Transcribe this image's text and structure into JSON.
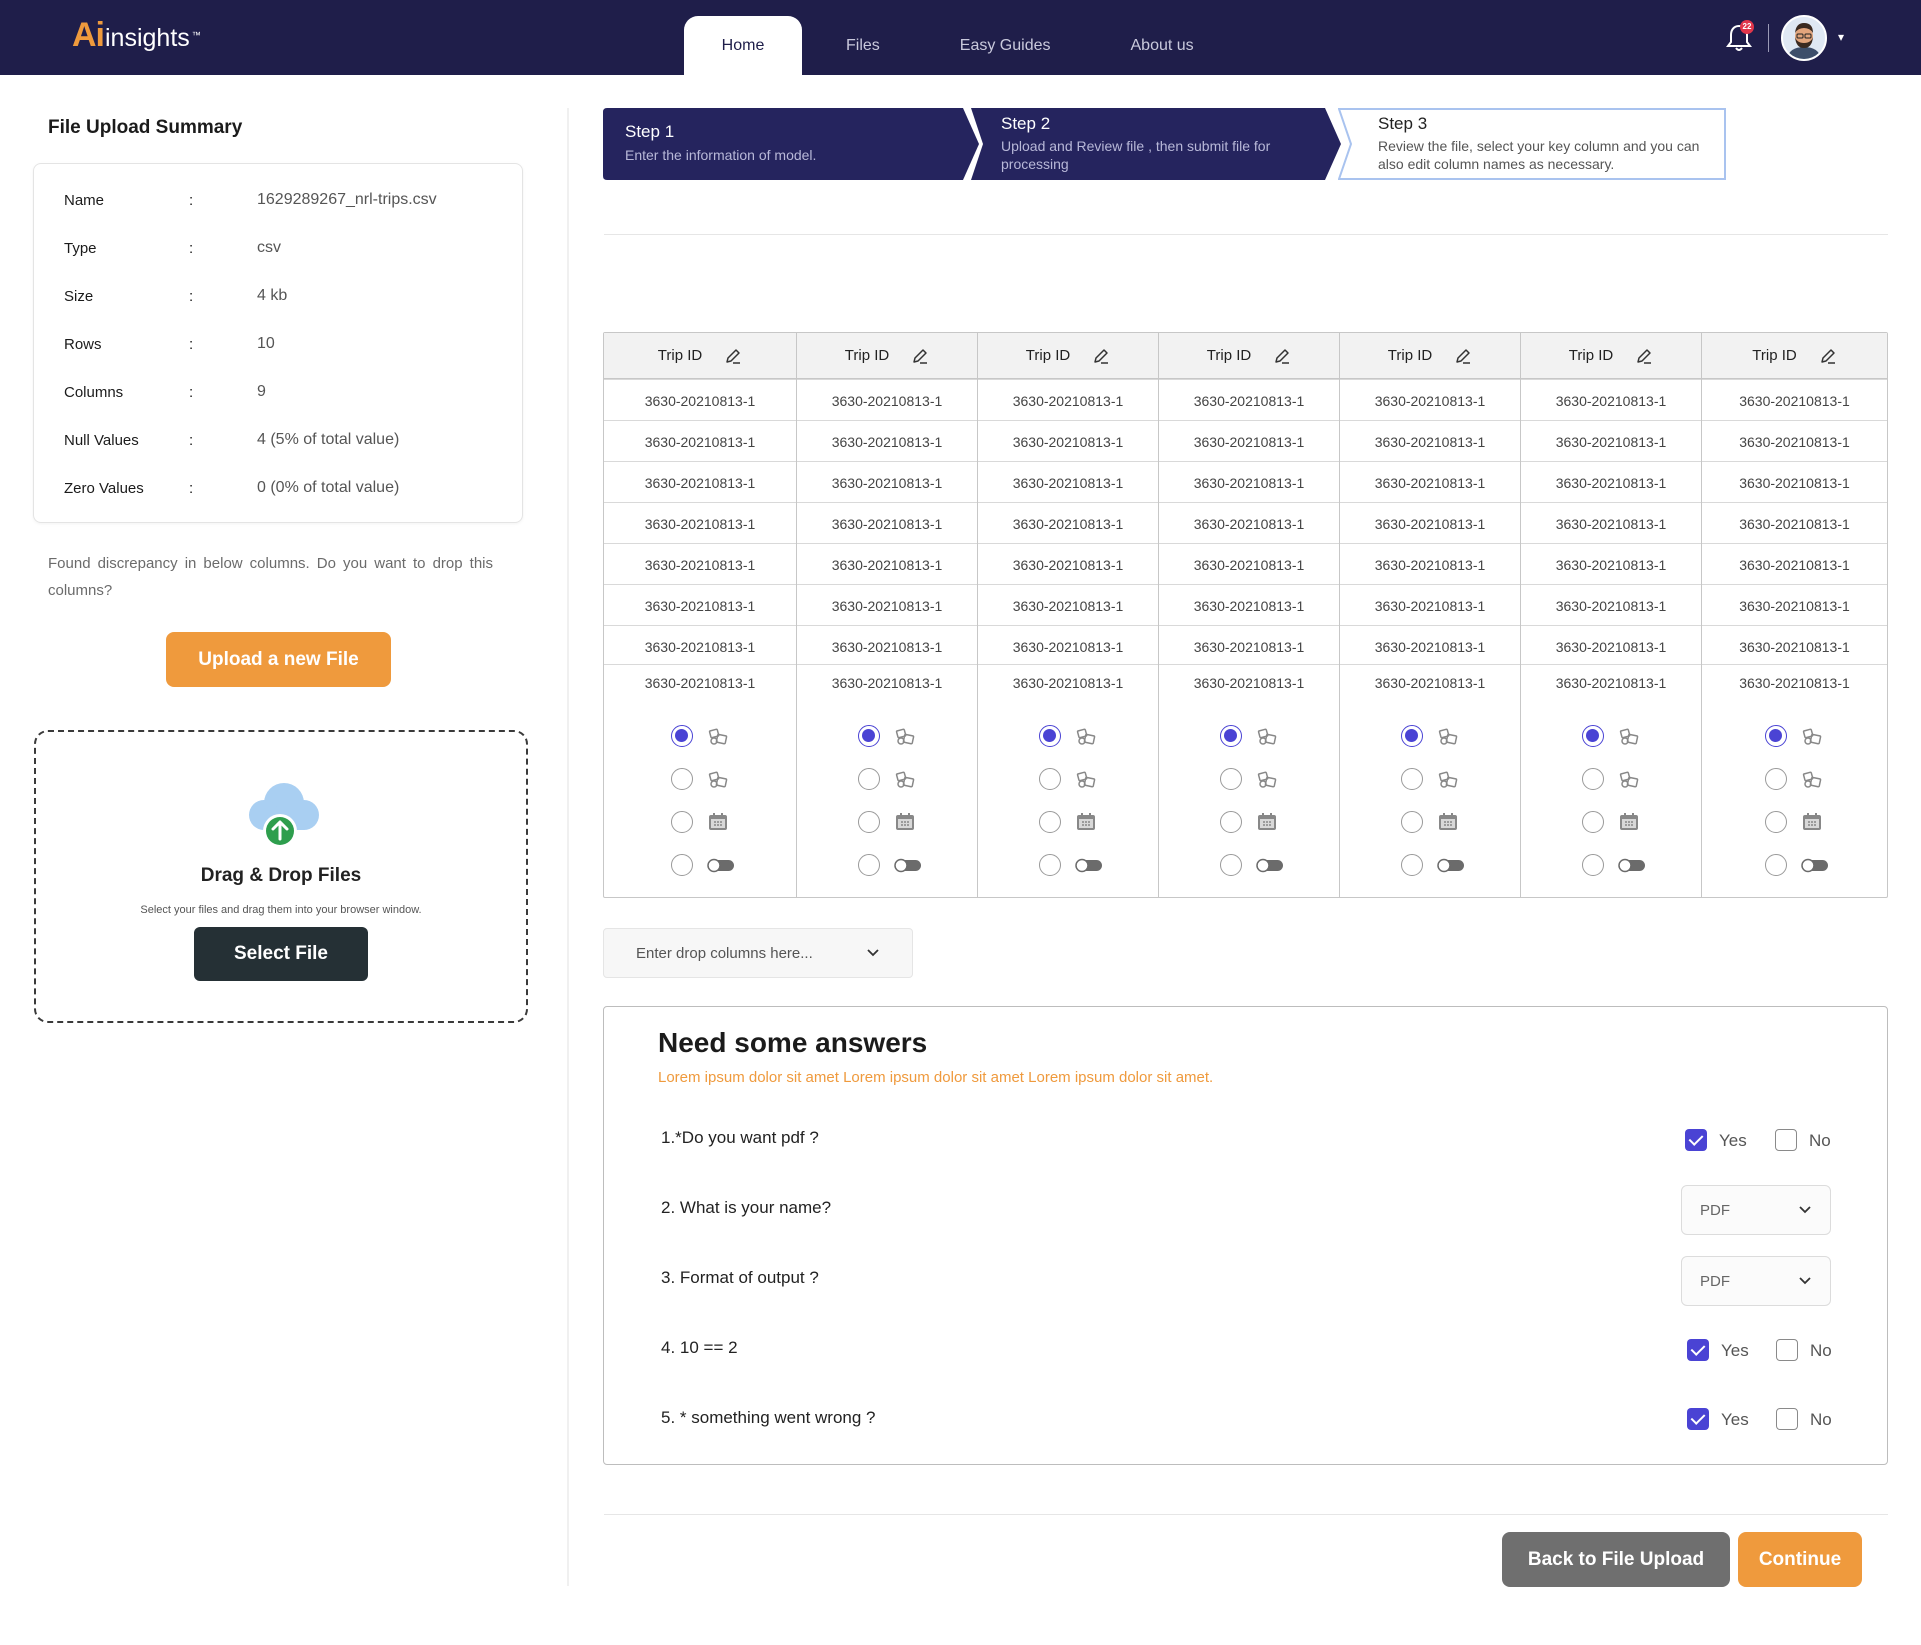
{
  "header": {
    "logo_ai": "Ai",
    "logo_rest": "insights",
    "logo_tm": "™",
    "tabs": [
      {
        "label": "Home",
        "active": true
      },
      {
        "label": "Files",
        "active": false
      },
      {
        "label": "Easy Guides",
        "active": false
      },
      {
        "label": "About us",
        "active": false
      }
    ],
    "notification_count": "22",
    "bell_icon": "bell-icon",
    "profile_caret": "▾"
  },
  "summary": {
    "title": "File Upload Summary",
    "colon": ":",
    "rows": [
      {
        "key": "Name",
        "value": "1629289267_nrl-trips.csv"
      },
      {
        "key": "Type",
        "value": "csv"
      },
      {
        "key": "Size",
        "value": "4 kb"
      },
      {
        "key": "Rows",
        "value": "10"
      },
      {
        "key": "Columns",
        "value": "9"
      },
      {
        "key": "Null Values",
        "value": "4 (5% of total value)"
      },
      {
        "key": "Zero Values",
        "value": "0 (0% of total value)"
      }
    ],
    "discrepancy_text": "Found discrepancy in below columns. Do you want to drop this columns?",
    "upload_button": "Upload a new File"
  },
  "dropzone": {
    "title": "Drag & Drop Files",
    "subtitle": "Select your files and drag them into your browser window.",
    "button": "Select File"
  },
  "steps": [
    {
      "title": "Step 1",
      "desc": "Enter the information of model."
    },
    {
      "title": "Step 2",
      "desc": "Upload and Review file , then submit file for processing"
    },
    {
      "title": "Step 3",
      "desc": "Review the file, select your key column and you can also edit column names as necessary."
    }
  ],
  "table": {
    "columns": [
      "Trip ID",
      "Trip ID",
      "Trip ID",
      "Trip ID",
      "Trip ID",
      "Trip ID",
      "Trip ID"
    ],
    "rows": [
      [
        "3630-20210813-1",
        "3630-20210813-1",
        "3630-20210813-1",
        "3630-20210813-1",
        "3630-20210813-1",
        "3630-20210813-1",
        "3630-20210813-1"
      ],
      [
        "3630-20210813-1",
        "3630-20210813-1",
        "3630-20210813-1",
        "3630-20210813-1",
        "3630-20210813-1",
        "3630-20210813-1",
        "3630-20210813-1"
      ],
      [
        "3630-20210813-1",
        "3630-20210813-1",
        "3630-20210813-1",
        "3630-20210813-1",
        "3630-20210813-1",
        "3630-20210813-1",
        "3630-20210813-1"
      ],
      [
        "3630-20210813-1",
        "3630-20210813-1",
        "3630-20210813-1",
        "3630-20210813-1",
        "3630-20210813-1",
        "3630-20210813-1",
        "3630-20210813-1"
      ],
      [
        "3630-20210813-1",
        "3630-20210813-1",
        "3630-20210813-1",
        "3630-20210813-1",
        "3630-20210813-1",
        "3630-20210813-1",
        "3630-20210813-1"
      ],
      [
        "3630-20210813-1",
        "3630-20210813-1",
        "3630-20210813-1",
        "3630-20210813-1",
        "3630-20210813-1",
        "3630-20210813-1",
        "3630-20210813-1"
      ],
      [
        "3630-20210813-1",
        "3630-20210813-1",
        "3630-20210813-1",
        "3630-20210813-1",
        "3630-20210813-1",
        "3630-20210813-1",
        "3630-20210813-1"
      ],
      [
        "3630-20210813-1",
        "3630-20210813-1",
        "3630-20210813-1",
        "3630-20210813-1",
        "3630-20210813-1",
        "3630-20210813-1",
        "3630-20210813-1"
      ]
    ],
    "type_options": [
      {
        "icon": "number-icon",
        "selected": true
      },
      {
        "icon": "number-icon",
        "selected": false
      },
      {
        "icon": "calendar-icon",
        "selected": false
      },
      {
        "icon": "toggle-icon",
        "selected": false
      }
    ],
    "edit_icon": "pencil-icon"
  },
  "drop_columns": {
    "placeholder": "Enter drop columns here..."
  },
  "questions": {
    "title": "Need some answers",
    "subtitle": "Lorem ipsum dolor sit amet Lorem ipsum dolor sit amet Lorem ipsum dolor sit amet.",
    "yes_label": "Yes",
    "no_label": "No",
    "items": [
      {
        "text": "1.*Do you want pdf ?",
        "type": "yesno",
        "yes": true,
        "no": false
      },
      {
        "text": "2. What is your name?",
        "type": "select",
        "value": "PDF"
      },
      {
        "text": "3. Format of output ?",
        "type": "select",
        "value": "PDF"
      },
      {
        "text": "4. 10 == 2",
        "type": "yesno",
        "yes": true,
        "no": false
      },
      {
        "text": "5. * something went wrong ?",
        "type": "yesno",
        "yes": true,
        "no": false
      }
    ]
  },
  "footer": {
    "back_button": "Back to File Upload",
    "continue_button": "Continue"
  },
  "colors": {
    "navy": "#1f1e4a",
    "accent_orange": "#ef9a3d",
    "primary_purple": "#4a43d4",
    "dark_button": "#253035",
    "step3_border": "#a9c3ef"
  }
}
